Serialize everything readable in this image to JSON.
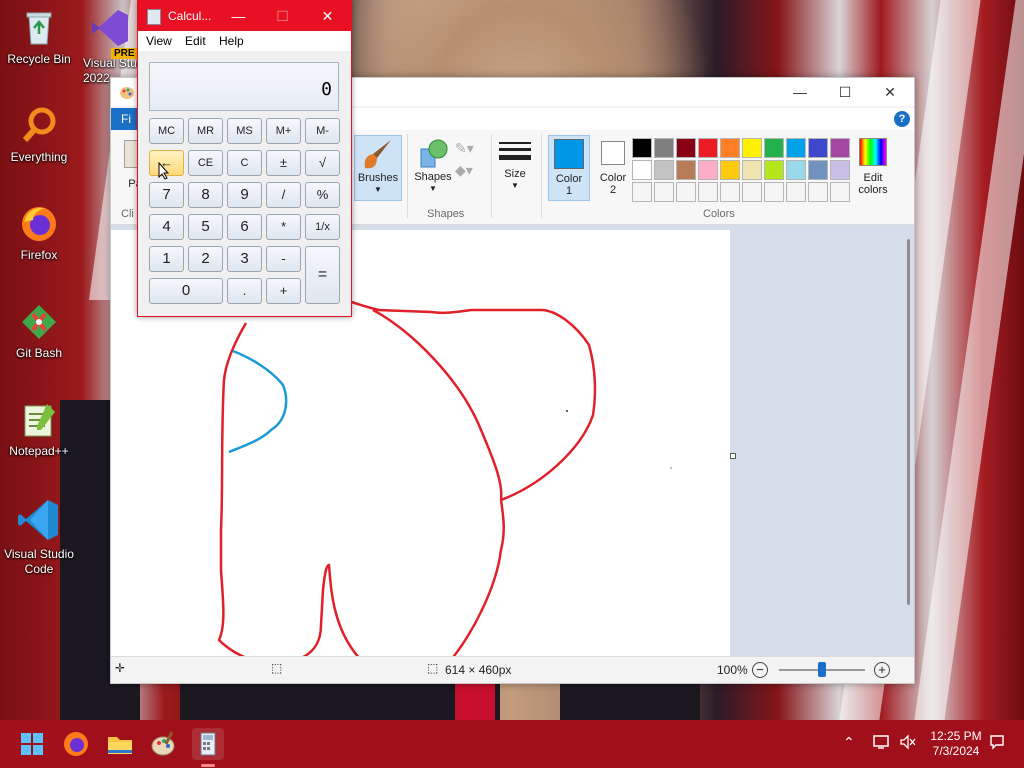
{
  "desktop": {
    "icons": [
      {
        "label": "Recycle Bin"
      },
      {
        "label": "Everything"
      },
      {
        "label": "Firefox"
      },
      {
        "label": "Git Bash"
      },
      {
        "label": "Notepad++"
      },
      {
        "label": "Visual Studio Code"
      },
      {
        "label": "Visual Studio 2022",
        "badge": "PRE"
      }
    ]
  },
  "paint": {
    "file_tab": "Fi",
    "ribbon": {
      "clipboard_paste_label": "Pa",
      "clipboard_group": "Cli",
      "brushes_label": "Brushes",
      "shapes_label": "Shapes",
      "shapes_group": "Shapes",
      "size_label": "Size",
      "color1_label": "Color 1",
      "color2_label": "Color 2",
      "edit_colors_label": "Edit colors",
      "colors_group": "Colors",
      "color1_value": "#0098e6",
      "color2_value": "#ffffff",
      "palette_row1": [
        "#000000",
        "#7f7f7f",
        "#880015",
        "#ed1c24",
        "#ff7f27",
        "#fff200",
        "#22b14c",
        "#00a2e8",
        "#3f48cc",
        "#a349a4"
      ],
      "palette_row2": [
        "#ffffff",
        "#c3c3c3",
        "#b97a57",
        "#ffaec9",
        "#ffc90e",
        "#efe4b0",
        "#b5e61d",
        "#99d9ea",
        "#7092be",
        "#c8bfe7"
      ]
    },
    "status": {
      "canvas_size": "614 × 460px",
      "zoom": "100%",
      "zoom_level": 0.5
    },
    "drawing": {
      "red_color": "#e0202a",
      "blue_color": "#1a9ad6"
    }
  },
  "calculator": {
    "title": "Calcul...",
    "menu": {
      "view": "View",
      "edit": "Edit",
      "help": "Help"
    },
    "display": "0",
    "keys": {
      "mc": "MC",
      "mr": "MR",
      "ms": "MS",
      "mplus": "M+",
      "mminus": "M-",
      "back": "←",
      "ce": "CE",
      "c": "C",
      "pm": "±",
      "sqrt": "√",
      "k7": "7",
      "k8": "8",
      "k9": "9",
      "div": "/",
      "pct": "%",
      "k4": "4",
      "k5": "5",
      "k6": "6",
      "mul": "*",
      "inv": "1/x",
      "k1": "1",
      "k2": "2",
      "k3": "3",
      "sub": "-",
      "eq": "=",
      "k0": "0",
      "dot": ".",
      "add": "+"
    }
  },
  "taskbar": {
    "time": "12:25 PM",
    "date": "7/3/2024"
  }
}
